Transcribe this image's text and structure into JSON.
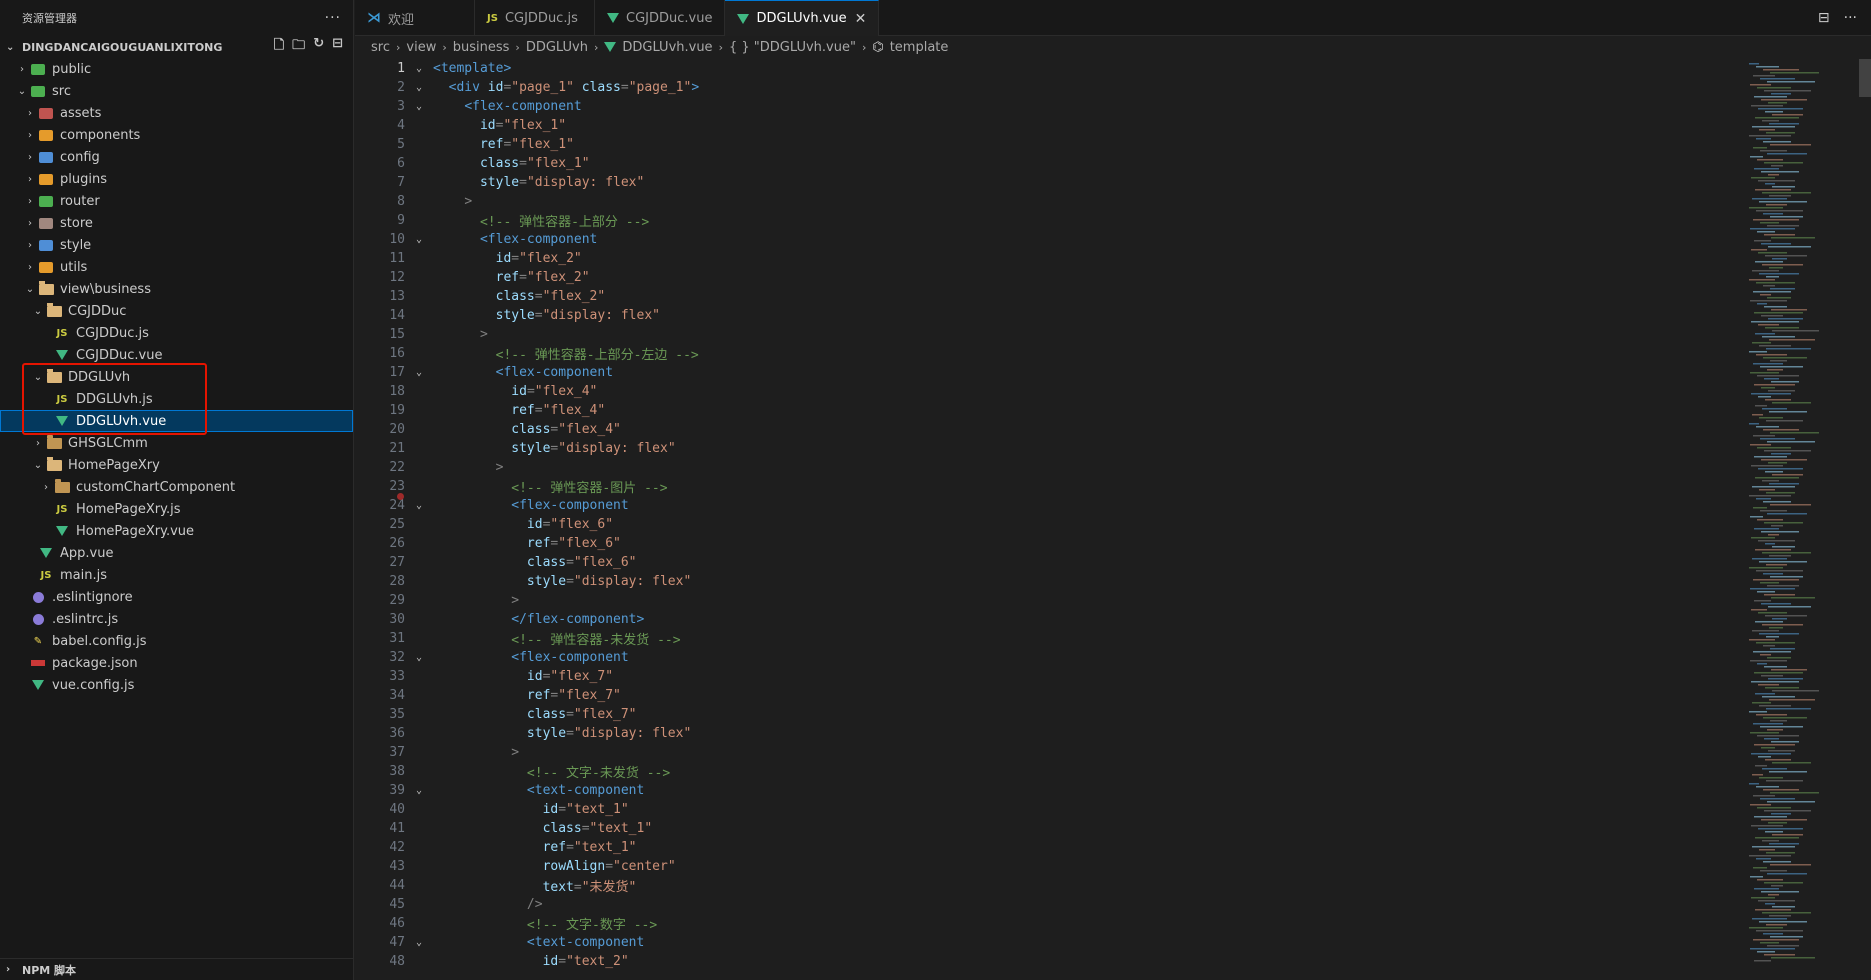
{
  "sidebar": {
    "title": "资源管理器",
    "more": "···",
    "project": "DINGDANCAIGOUGUANLIXITONG",
    "footer": "NPM 脚本",
    "tree": [
      {
        "label": "public",
        "indent": 1,
        "twisty": "›",
        "icon": "green"
      },
      {
        "label": "src",
        "indent": 1,
        "twisty": "⌄",
        "icon": "green"
      },
      {
        "label": "assets",
        "indent": 2,
        "twisty": "›",
        "icon": "red"
      },
      {
        "label": "components",
        "indent": 2,
        "twisty": "›",
        "icon": "orange"
      },
      {
        "label": "config",
        "indent": 2,
        "twisty": "›",
        "icon": "blue"
      },
      {
        "label": "plugins",
        "indent": 2,
        "twisty": "›",
        "icon": "orange"
      },
      {
        "label": "router",
        "indent": 2,
        "twisty": "›",
        "icon": "green"
      },
      {
        "label": "store",
        "indent": 2,
        "twisty": "›",
        "icon": "brown"
      },
      {
        "label": "style",
        "indent": 2,
        "twisty": "›",
        "icon": "blue"
      },
      {
        "label": "utils",
        "indent": 2,
        "twisty": "›",
        "icon": "orange"
      },
      {
        "label": "view\\business",
        "indent": 2,
        "twisty": "⌄",
        "icon": "folder-open"
      },
      {
        "label": "CGJDDuc",
        "indent": 3,
        "twisty": "⌄",
        "icon": "folder-open"
      },
      {
        "label": "CGJDDuc.js",
        "indent": 4,
        "twisty": "",
        "icon": "js"
      },
      {
        "label": "CGJDDuc.vue",
        "indent": 4,
        "twisty": "",
        "icon": "vue"
      },
      {
        "label": "DDGLUvh",
        "indent": 3,
        "twisty": "⌄",
        "icon": "folder-open"
      },
      {
        "label": "DDGLUvh.js",
        "indent": 4,
        "twisty": "",
        "icon": "js"
      },
      {
        "label": "DDGLUvh.vue",
        "indent": 4,
        "twisty": "",
        "icon": "vue",
        "selected": true
      },
      {
        "label": "GHSGLCmm",
        "indent": 3,
        "twisty": "›",
        "icon": "folder"
      },
      {
        "label": "HomePageXry",
        "indent": 3,
        "twisty": "⌄",
        "icon": "folder-open"
      },
      {
        "label": "customChartComponent",
        "indent": 4,
        "twisty": "›",
        "icon": "folder"
      },
      {
        "label": "HomePageXry.js",
        "indent": 4,
        "twisty": "",
        "icon": "js"
      },
      {
        "label": "HomePageXry.vue",
        "indent": 4,
        "twisty": "",
        "icon": "vue"
      },
      {
        "label": "App.vue",
        "indent": 2,
        "twisty": "",
        "icon": "vue"
      },
      {
        "label": "main.js",
        "indent": 2,
        "twisty": "",
        "icon": "js"
      },
      {
        "label": ".eslintignore",
        "indent": 1,
        "twisty": "",
        "icon": "purple"
      },
      {
        "label": ".eslintrc.js",
        "indent": 1,
        "twisty": "",
        "icon": "purple"
      },
      {
        "label": "babel.config.js",
        "indent": 1,
        "twisty": "",
        "icon": "babel"
      },
      {
        "label": "package.json",
        "indent": 1,
        "twisty": "",
        "icon": "npm"
      },
      {
        "label": "vue.config.js",
        "indent": 1,
        "twisty": "",
        "icon": "vue"
      }
    ]
  },
  "tabs": [
    {
      "label": "欢迎",
      "icon": "vscode"
    },
    {
      "label": "CGJDDuc.js",
      "icon": "js"
    },
    {
      "label": "CGJDDuc.vue",
      "icon": "vue"
    },
    {
      "label": "DDGLUvh.vue",
      "icon": "vue",
      "active": true
    }
  ],
  "breadcrumb": [
    "src",
    "view",
    "business",
    "DDGLUvh",
    "DDGLUvh.vue",
    "{ } \"DDGLUvh.vue\"",
    "template"
  ],
  "icons": {
    "js": "JS",
    "close": "✕",
    "split": "⊟",
    "more": "···"
  },
  "code": [
    {
      "n": "1",
      "fold": "⌄",
      "t": [
        [
          "tag",
          "<template>"
        ]
      ],
      "current": true
    },
    {
      "n": "2",
      "fold": "⌄",
      "t": [
        [
          "pun",
          "  "
        ],
        [
          "tag",
          "<div"
        ],
        [
          "pun",
          " "
        ],
        [
          "attr",
          "id"
        ],
        [
          "pun",
          "="
        ],
        [
          "str",
          "\"page_1\""
        ],
        [
          "pun",
          " "
        ],
        [
          "attr",
          "class"
        ],
        [
          "pun",
          "="
        ],
        [
          "str",
          "\"page_1\""
        ],
        [
          "tag",
          ">"
        ]
      ]
    },
    {
      "n": "3",
      "fold": "⌄",
      "t": [
        [
          "pun",
          "    "
        ],
        [
          "tag",
          "<flex-component"
        ]
      ]
    },
    {
      "n": "4",
      "fold": "",
      "t": [
        [
          "pun",
          "      "
        ],
        [
          "attr",
          "id"
        ],
        [
          "pun",
          "="
        ],
        [
          "str",
          "\"flex_1\""
        ]
      ]
    },
    {
      "n": "5",
      "fold": "",
      "t": [
        [
          "pun",
          "      "
        ],
        [
          "attr",
          "ref"
        ],
        [
          "pun",
          "="
        ],
        [
          "str",
          "\"flex_1\""
        ]
      ]
    },
    {
      "n": "6",
      "fold": "",
      "t": [
        [
          "pun",
          "      "
        ],
        [
          "attr",
          "class"
        ],
        [
          "pun",
          "="
        ],
        [
          "str",
          "\"flex_1\""
        ]
      ]
    },
    {
      "n": "7",
      "fold": "",
      "t": [
        [
          "pun",
          "      "
        ],
        [
          "attr",
          "style"
        ],
        [
          "pun",
          "="
        ],
        [
          "str",
          "\"display: flex\""
        ]
      ]
    },
    {
      "n": "8",
      "fold": "",
      "t": [
        [
          "pun",
          "    "
        ],
        [
          "pun",
          ">"
        ]
      ]
    },
    {
      "n": "9",
      "fold": "",
      "t": [
        [
          "pun",
          "      "
        ],
        [
          "cm",
          "<!-- 弹性容器-上部分 -->"
        ]
      ]
    },
    {
      "n": "10",
      "fold": "⌄",
      "t": [
        [
          "pun",
          "      "
        ],
        [
          "tag",
          "<flex-component"
        ]
      ]
    },
    {
      "n": "11",
      "fold": "",
      "t": [
        [
          "pun",
          "        "
        ],
        [
          "attr",
          "id"
        ],
        [
          "pun",
          "="
        ],
        [
          "str",
          "\"flex_2\""
        ]
      ]
    },
    {
      "n": "12",
      "fold": "",
      "t": [
        [
          "pun",
          "        "
        ],
        [
          "attr",
          "ref"
        ],
        [
          "pun",
          "="
        ],
        [
          "str",
          "\"flex_2\""
        ]
      ]
    },
    {
      "n": "13",
      "fold": "",
      "t": [
        [
          "pun",
          "        "
        ],
        [
          "attr",
          "class"
        ],
        [
          "pun",
          "="
        ],
        [
          "str",
          "\"flex_2\""
        ]
      ]
    },
    {
      "n": "14",
      "fold": "",
      "t": [
        [
          "pun",
          "        "
        ],
        [
          "attr",
          "style"
        ],
        [
          "pun",
          "="
        ],
        [
          "str",
          "\"display: flex\""
        ]
      ]
    },
    {
      "n": "15",
      "fold": "",
      "t": [
        [
          "pun",
          "      "
        ],
        [
          "pun",
          ">"
        ]
      ]
    },
    {
      "n": "16",
      "fold": "",
      "t": [
        [
          "pun",
          "        "
        ],
        [
          "cm",
          "<!-- 弹性容器-上部分-左边 -->"
        ]
      ]
    },
    {
      "n": "17",
      "fold": "⌄",
      "t": [
        [
          "pun",
          "        "
        ],
        [
          "tag",
          "<flex-component"
        ]
      ]
    },
    {
      "n": "18",
      "fold": "",
      "t": [
        [
          "pun",
          "          "
        ],
        [
          "attr",
          "id"
        ],
        [
          "pun",
          "="
        ],
        [
          "str",
          "\"flex_4\""
        ]
      ]
    },
    {
      "n": "19",
      "fold": "",
      "t": [
        [
          "pun",
          "          "
        ],
        [
          "attr",
          "ref"
        ],
        [
          "pun",
          "="
        ],
        [
          "str",
          "\"flex_4\""
        ]
      ]
    },
    {
      "n": "20",
      "fold": "",
      "t": [
        [
          "pun",
          "          "
        ],
        [
          "attr",
          "class"
        ],
        [
          "pun",
          "="
        ],
        [
          "str",
          "\"flex_4\""
        ]
      ]
    },
    {
      "n": "21",
      "fold": "",
      "t": [
        [
          "pun",
          "          "
        ],
        [
          "attr",
          "style"
        ],
        [
          "pun",
          "="
        ],
        [
          "str",
          "\"display: flex\""
        ]
      ]
    },
    {
      "n": "22",
      "fold": "",
      "t": [
        [
          "pun",
          "        "
        ],
        [
          "pun",
          ">"
        ]
      ]
    },
    {
      "n": "23",
      "fold": "",
      "t": [
        [
          "pun",
          "          "
        ],
        [
          "cm",
          "<!-- 弹性容器-图片 -->"
        ]
      ],
      "bp": true
    },
    {
      "n": "24",
      "fold": "⌄",
      "t": [
        [
          "pun",
          "          "
        ],
        [
          "tag",
          "<flex-component"
        ]
      ]
    },
    {
      "n": "25",
      "fold": "",
      "t": [
        [
          "pun",
          "            "
        ],
        [
          "attr",
          "id"
        ],
        [
          "pun",
          "="
        ],
        [
          "str",
          "\"flex_6\""
        ]
      ]
    },
    {
      "n": "26",
      "fold": "",
      "t": [
        [
          "pun",
          "            "
        ],
        [
          "attr",
          "ref"
        ],
        [
          "pun",
          "="
        ],
        [
          "str",
          "\"flex_6\""
        ]
      ]
    },
    {
      "n": "27",
      "fold": "",
      "t": [
        [
          "pun",
          "            "
        ],
        [
          "attr",
          "class"
        ],
        [
          "pun",
          "="
        ],
        [
          "str",
          "\"flex_6\""
        ]
      ]
    },
    {
      "n": "28",
      "fold": "",
      "t": [
        [
          "pun",
          "            "
        ],
        [
          "attr",
          "style"
        ],
        [
          "pun",
          "="
        ],
        [
          "str",
          "\"display: flex\""
        ]
      ]
    },
    {
      "n": "29",
      "fold": "",
      "t": [
        [
          "pun",
          "          "
        ],
        [
          "pun",
          ">"
        ]
      ]
    },
    {
      "n": "30",
      "fold": "",
      "t": [
        [
          "pun",
          "          "
        ],
        [
          "tag",
          "</flex-component>"
        ]
      ]
    },
    {
      "n": "31",
      "fold": "",
      "t": [
        [
          "pun",
          "          "
        ],
        [
          "cm",
          "<!-- 弹性容器-未发货 -->"
        ]
      ]
    },
    {
      "n": "32",
      "fold": "⌄",
      "t": [
        [
          "pun",
          "          "
        ],
        [
          "tag",
          "<flex-component"
        ]
      ]
    },
    {
      "n": "33",
      "fold": "",
      "t": [
        [
          "pun",
          "            "
        ],
        [
          "attr",
          "id"
        ],
        [
          "pun",
          "="
        ],
        [
          "str",
          "\"flex_7\""
        ]
      ]
    },
    {
      "n": "34",
      "fold": "",
      "t": [
        [
          "pun",
          "            "
        ],
        [
          "attr",
          "ref"
        ],
        [
          "pun",
          "="
        ],
        [
          "str",
          "\"flex_7\""
        ]
      ]
    },
    {
      "n": "35",
      "fold": "",
      "t": [
        [
          "pun",
          "            "
        ],
        [
          "attr",
          "class"
        ],
        [
          "pun",
          "="
        ],
        [
          "str",
          "\"flex_7\""
        ]
      ]
    },
    {
      "n": "36",
      "fold": "",
      "t": [
        [
          "pun",
          "            "
        ],
        [
          "attr",
          "style"
        ],
        [
          "pun",
          "="
        ],
        [
          "str",
          "\"display: flex\""
        ]
      ]
    },
    {
      "n": "37",
      "fold": "",
      "t": [
        [
          "pun",
          "          "
        ],
        [
          "pun",
          ">"
        ]
      ]
    },
    {
      "n": "38",
      "fold": "",
      "t": [
        [
          "pun",
          "            "
        ],
        [
          "cm",
          "<!-- 文字-未发货 -->"
        ]
      ]
    },
    {
      "n": "39",
      "fold": "⌄",
      "t": [
        [
          "pun",
          "            "
        ],
        [
          "tag",
          "<text-component"
        ]
      ]
    },
    {
      "n": "40",
      "fold": "",
      "t": [
        [
          "pun",
          "              "
        ],
        [
          "attr",
          "id"
        ],
        [
          "pun",
          "="
        ],
        [
          "str",
          "\"text_1\""
        ]
      ]
    },
    {
      "n": "41",
      "fold": "",
      "t": [
        [
          "pun",
          "              "
        ],
        [
          "attr",
          "class"
        ],
        [
          "pun",
          "="
        ],
        [
          "str",
          "\"text_1\""
        ]
      ]
    },
    {
      "n": "42",
      "fold": "",
      "t": [
        [
          "pun",
          "              "
        ],
        [
          "attr",
          "ref"
        ],
        [
          "pun",
          "="
        ],
        [
          "str",
          "\"text_1\""
        ]
      ]
    },
    {
      "n": "43",
      "fold": "",
      "t": [
        [
          "pun",
          "              "
        ],
        [
          "attr",
          "rowAlign"
        ],
        [
          "pun",
          "="
        ],
        [
          "str",
          "\"center\""
        ]
      ]
    },
    {
      "n": "44",
      "fold": "",
      "t": [
        [
          "pun",
          "              "
        ],
        [
          "attr",
          "text"
        ],
        [
          "pun",
          "="
        ],
        [
          "str",
          "\"未发货\""
        ]
      ]
    },
    {
      "n": "45",
      "fold": "",
      "t": [
        [
          "pun",
          "            "
        ],
        [
          "pun",
          "/>"
        ]
      ]
    },
    {
      "n": "46",
      "fold": "",
      "t": [
        [
          "pun",
          "            "
        ],
        [
          "cm",
          "<!-- 文字-数字 -->"
        ]
      ]
    },
    {
      "n": "47",
      "fold": "⌄",
      "t": [
        [
          "pun",
          "            "
        ],
        [
          "tag",
          "<text-component"
        ]
      ]
    },
    {
      "n": "48",
      "fold": "",
      "t": [
        [
          "pun",
          "              "
        ],
        [
          "attr",
          "id"
        ],
        [
          "pun",
          "="
        ],
        [
          "str",
          "\"text_2\""
        ]
      ]
    }
  ]
}
